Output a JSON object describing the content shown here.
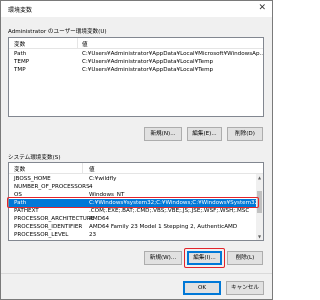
{
  "window": {
    "title": "環境変数",
    "close_glyph": "✕"
  },
  "user_vars": {
    "group_label": "Administrator のユーザー環境変数(U)",
    "col_var": "変数",
    "col_val": "値",
    "rows": [
      {
        "name": "Path",
        "value": "C:¥Users¥Administrator¥AppData¥Local¥Microsoft¥WindowsAp..."
      },
      {
        "name": "TEMP",
        "value": "C:¥Users¥Administrator¥AppData¥Local¥Temp"
      },
      {
        "name": "TMP",
        "value": "C:¥Users¥Administrator¥AppData¥Local¥Temp"
      }
    ],
    "buttons": {
      "new": "新規(N)...",
      "edit": "編集(E)...",
      "delete": "削除(D)"
    }
  },
  "system_vars": {
    "group_label": "システム環境変数(S)",
    "col_var": "変数",
    "col_val": "値",
    "rows": [
      {
        "name": "JBOSS_HOME",
        "value": "C:¥wildfly"
      },
      {
        "name": "NUMBER_OF_PROCESSORS",
        "value": "4"
      },
      {
        "name": "OS",
        "value": "Windows_NT"
      },
      {
        "name": "Path",
        "value": "C:¥Windows¥system32;C:¥Windows;C:¥Windows¥System32¥W..."
      },
      {
        "name": "PATHEXT",
        "value": ".COM;.EXE;.BAT;.CMD;.VBS;.VBE;.JS;.JSE;.WSF;.WSH;.MSC"
      },
      {
        "name": "PROCESSOR_ARCHITECTURE",
        "value": "AMD64"
      },
      {
        "name": "PROCESSOR_IDENTIFIER",
        "value": "AMD64 Family 23 Model 1 Stepping 2, AuthenticAMD"
      },
      {
        "name": "PROCESSOR_LEVEL",
        "value": "23"
      }
    ],
    "selected_index": 3,
    "buttons": {
      "new": "新規(W)...",
      "edit": "編集(I)...",
      "delete": "削除(L)"
    }
  },
  "footer": {
    "ok": "OK",
    "cancel": "キャンセル"
  },
  "colors": {
    "selection": "#0078d7",
    "highlight": "#e3242b"
  }
}
